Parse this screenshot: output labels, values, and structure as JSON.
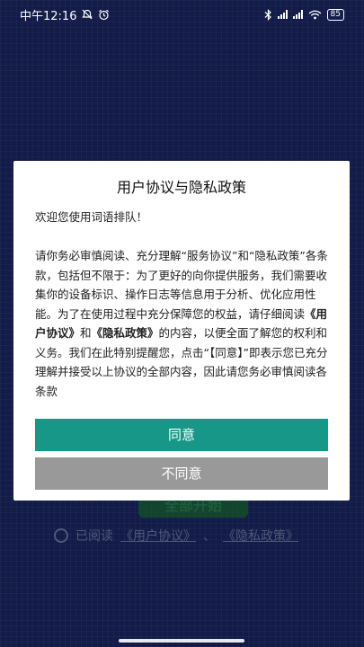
{
  "status_bar": {
    "time": "中午12:16",
    "battery": "85"
  },
  "background_screen": {
    "start_button_label": "全部开始",
    "agree_prefix": "已阅读",
    "user_agreement_link": "《用户协议》",
    "separator": "、",
    "privacy_link": "《隐私政策》"
  },
  "dialog": {
    "title": "用户协议与隐私政策",
    "welcome": "欢迎您使用词语排队！",
    "body_part1": "请你务必审慎阅读、充分理解“服务协议”和“隐私政策”各条款，包括但不限于：为了更好的向你提供服务，我们需要收集你的设备标识、操作日志等信息用于分析、优化应用性能。为了在使用过程中充分保障您的权益，请仔细阅读",
    "link_user_agreement": "《用户协议》",
    "and": "和",
    "link_privacy": "《隐私政策》",
    "body_part2": "的内容，以便全面了解您的权利和义务。我们在此特别提醒您，点击“【同意】”即表示您已充分理解并接受以上协议的全部内容，因此请您务必审慎阅读各条款",
    "agree_button": "同意",
    "disagree_button": "不同意"
  },
  "colors": {
    "agree": "#169787",
    "disagree": "#999999",
    "background": "#1f2d73"
  }
}
